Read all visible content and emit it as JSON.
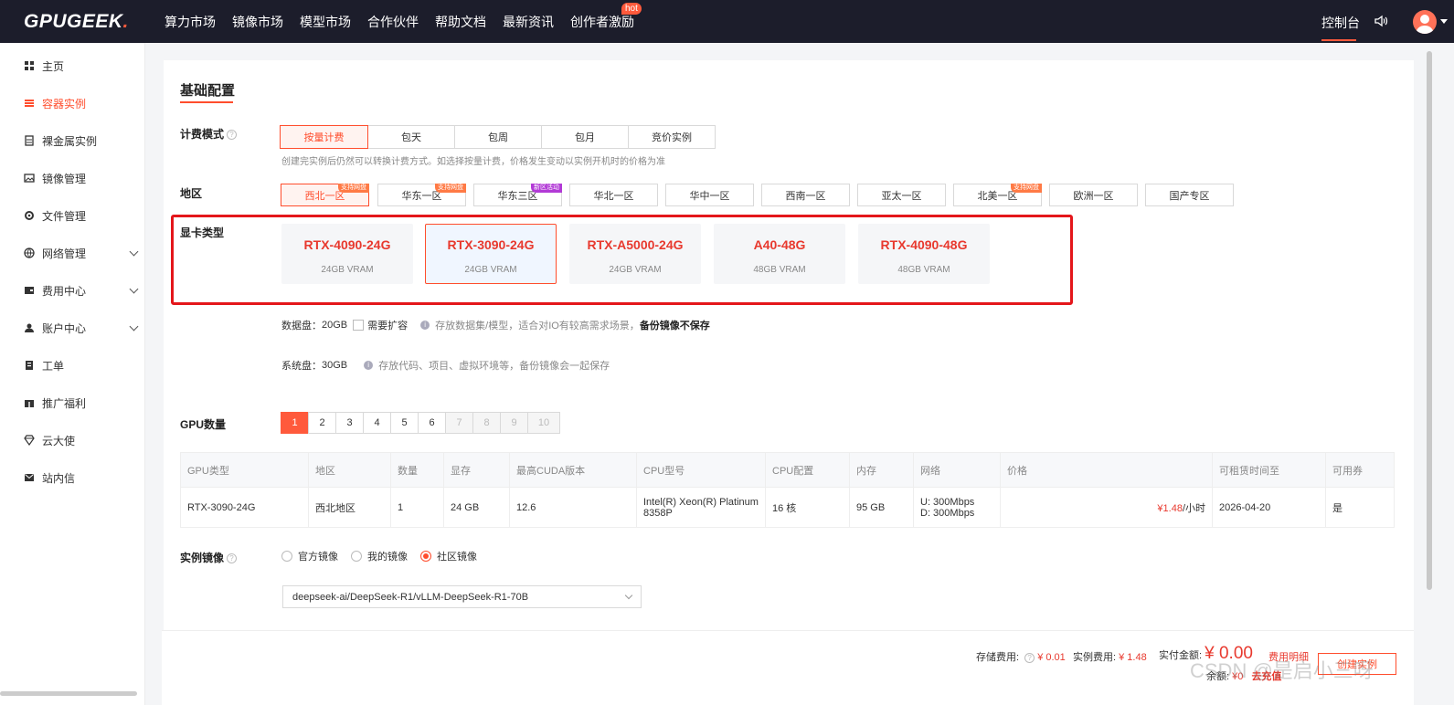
{
  "header": {
    "logo_main": "GPUGEEK",
    "logo_dot": ".",
    "nav": [
      "算力市场",
      "镜像市场",
      "模型市场",
      "合作伙伴",
      "帮助文档",
      "最新资讯",
      "创作者激励"
    ],
    "hot_badge": "hot",
    "console": "控制台",
    "accent_color": "#ff4d2d",
    "bg_color": "#1c1d2b"
  },
  "sidebar": {
    "items": [
      {
        "label": "主页",
        "icon": "grid-icon"
      },
      {
        "label": "容器实例",
        "icon": "list-icon"
      },
      {
        "label": "裸金属实例",
        "icon": "server-icon"
      },
      {
        "label": "镜像管理",
        "icon": "image-icon"
      },
      {
        "label": "文件管理",
        "icon": "gear-icon"
      },
      {
        "label": "网络管理",
        "icon": "network-icon"
      },
      {
        "label": "费用中心",
        "icon": "wallet-icon"
      },
      {
        "label": "账户中心",
        "icon": "user-icon"
      },
      {
        "label": "工单",
        "icon": "ticket-icon"
      },
      {
        "label": "推广福利",
        "icon": "gift-icon"
      },
      {
        "label": "云大使",
        "icon": "diamond-icon"
      },
      {
        "label": "站内信",
        "icon": "mail-icon"
      }
    ],
    "active_index": 1
  },
  "form": {
    "section_title": "基础配置",
    "billing": {
      "label": "计费模式",
      "options": [
        "按量计费",
        "包天",
        "包周",
        "包月",
        "竞价实例"
      ],
      "hint": "创建完实例后仍然可以转换计费方式。如选择按量计费，价格发生变动以实例开机时的价格为准"
    },
    "region": {
      "label": "地区",
      "options": [
        {
          "name": "西北一区",
          "tag": "支持网盘"
        },
        {
          "name": "华东一区",
          "tag": "支持网盘"
        },
        {
          "name": "华东三区",
          "tag": "新区活动"
        },
        {
          "name": "华北一区",
          "tag": ""
        },
        {
          "name": "华中一区",
          "tag": ""
        },
        {
          "name": "西南一区",
          "tag": ""
        },
        {
          "name": "亚太一区",
          "tag": ""
        },
        {
          "name": "北美一区",
          "tag": "支持网盘"
        },
        {
          "name": "欧洲一区",
          "tag": ""
        },
        {
          "name": "国产专区",
          "tag": ""
        }
      ]
    },
    "gpu_type": {
      "label": "显卡类型",
      "cards": [
        {
          "name": "RTX-4090-24G",
          "mem": "24GB VRAM"
        },
        {
          "name": "RTX-3090-24G",
          "mem": "24GB VRAM"
        },
        {
          "name": "RTX-A5000-24G",
          "mem": "24GB VRAM"
        },
        {
          "name": "A40-48G",
          "mem": "48GB VRAM"
        },
        {
          "name": "RTX-4090-48G",
          "mem": "48GB VRAM"
        }
      ]
    },
    "data_disk": {
      "label": "数据盘：",
      "value": "20GB",
      "checkbox_label": "需要扩容",
      "hint": "存放数据集/模型，适合对IO有较高需求场景，",
      "hint_bold": "备份镜像不保存"
    },
    "system_disk": {
      "label": "系统盘：",
      "value": "30GB",
      "hint": "存放代码、项目、虚拟环境等，备份镜像会一起保存"
    },
    "gpu_count": {
      "label": "GPU数量",
      "options": [
        "1",
        "2",
        "3",
        "4",
        "5",
        "6",
        "7",
        "8",
        "9",
        "10"
      ]
    },
    "table": {
      "headers": [
        "GPU类型",
        "地区",
        "数量",
        "显存",
        "最高CUDA版本",
        "CPU型号",
        "CPU配置",
        "内存",
        "网络",
        "价格",
        "可租赁时间至",
        "可用券"
      ],
      "row": {
        "gpu": "RTX-3090-24G",
        "region": "西北地区",
        "count": "1",
        "vram": "24 GB",
        "cuda": "12.6",
        "cpu_model": "Intel(R) Xeon(R) Platinum 8358P",
        "cpu_cfg": "16 核",
        "memory": "95 GB",
        "net_up": "U: 300Mbps",
        "net_down": "D: 300Mbps",
        "price": "¥1.48",
        "price_unit": "/小时",
        "until": "2026-04-20",
        "coupon": "是"
      }
    },
    "image": {
      "label": "实例镜像",
      "options": [
        "官方镜像",
        "我的镜像",
        "社区镜像"
      ],
      "selected": "deepseek-ai/DeepSeek-R1/vLLM-DeepSeek-R1-70B"
    }
  },
  "footer": {
    "storage_label": "存储费用:",
    "storage_value": "¥ 0.01",
    "instance_label": "实例费用:",
    "instance_value": "¥ 1.48",
    "total_label": "实付金额:",
    "total_value": "¥ 0.00",
    "detail_link": "费用明细",
    "balance_label": "余额:",
    "balance_value": "¥0",
    "recharge": "去充值",
    "create_button": "创建实例",
    "watermark": "CSDN @是启小三呀"
  }
}
